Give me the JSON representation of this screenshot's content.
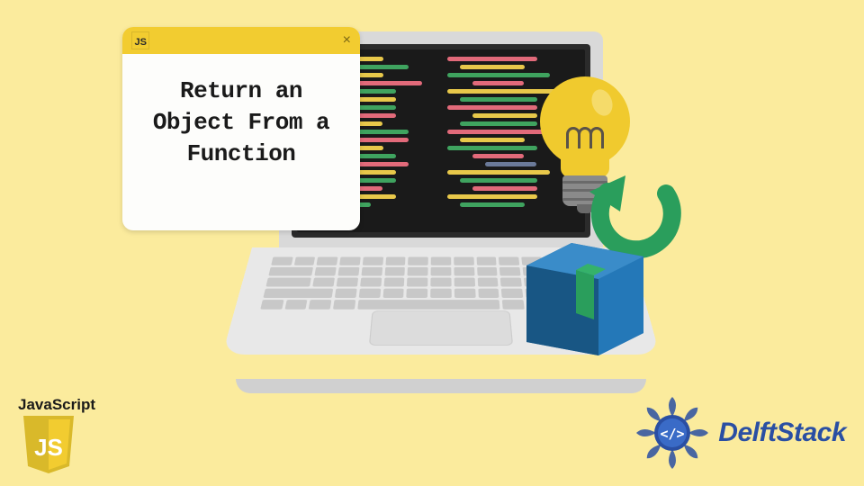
{
  "popup": {
    "icon_label": "JS",
    "close_glyph": "×",
    "title": "Return an Object From a Function"
  },
  "js_logo": {
    "label": "JavaScript",
    "shield_text": "JS"
  },
  "brand": {
    "name": "DelftStack",
    "emblem_glyph": "</>"
  },
  "colors": {
    "bg": "#fbeb9d",
    "yellow": "#f2cc30",
    "blue": "#2a4fa3",
    "green": "#2a9e5c",
    "box_blue": "#1f6aa5"
  },
  "icons": {
    "bulb": "lightbulb-icon",
    "arrow": "return-arrow-icon",
    "box": "box-icon",
    "laptop": "laptop-icon"
  }
}
